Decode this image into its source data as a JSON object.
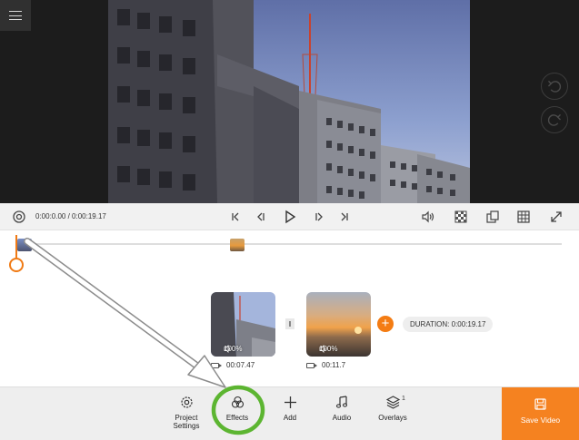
{
  "player": {
    "time_display": "0:00:0.00 / 0:00:19.17"
  },
  "icons": {
    "menu": "hamburger-menu-icon",
    "undo": "undo-icon",
    "redo": "redo-icon",
    "settings": "gear-icon",
    "skip_start": "skip-to-start-icon",
    "prev_frame": "previous-frame-icon",
    "play": "play-icon",
    "next_frame": "next-frame-icon",
    "skip_end": "skip-to-end-icon",
    "volume": "volume-icon",
    "background": "checkerboard-icon",
    "aspect": "aspect-ratio-icon",
    "grid": "grid-icon",
    "fullscreen": "fullscreen-icon"
  },
  "timeline": {
    "clips": [
      {
        "volume": "100%",
        "duration": "00:07.47"
      },
      {
        "volume": "100%",
        "duration": "00:11.7"
      }
    ],
    "duration_label": "DURATION: 0:00:19.17"
  },
  "toolbar": {
    "project_settings_line1": "Project",
    "project_settings_line2": "Settings",
    "effects": "Effects",
    "add": "Add",
    "audio": "Audio",
    "overlays": "Overlays",
    "overlays_count": "1",
    "save_video": "Save Video"
  },
  "colors": {
    "accent": "#f58220",
    "annotation_green": "#5cb531"
  }
}
